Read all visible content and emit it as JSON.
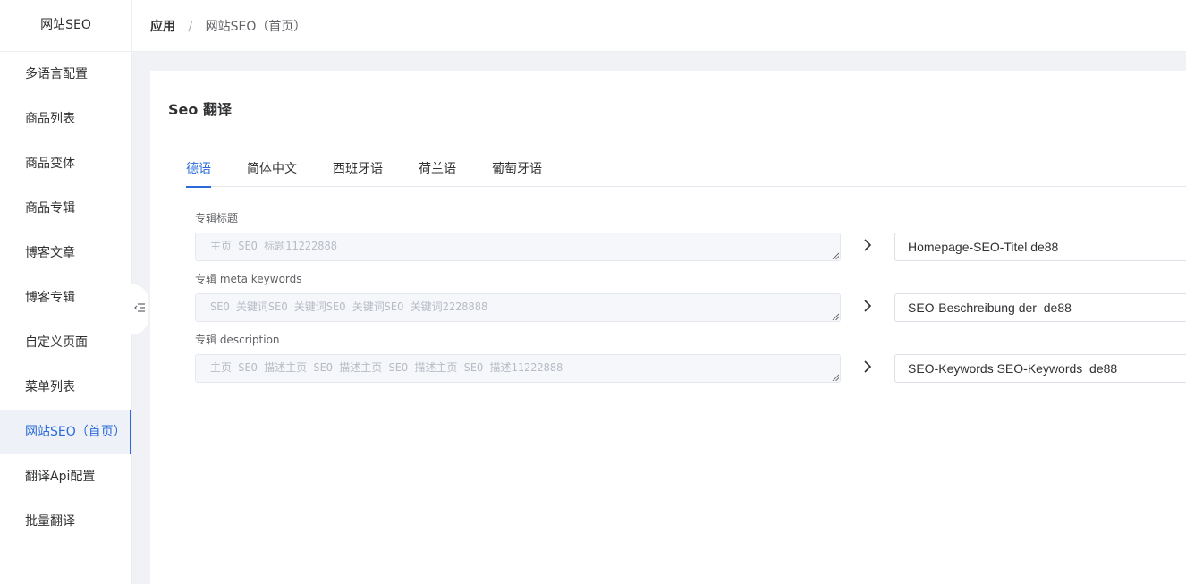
{
  "sidebar": {
    "brand": "网站SEO",
    "items": [
      {
        "label": "多语言配置",
        "active": false
      },
      {
        "label": "商品列表",
        "active": false
      },
      {
        "label": "商品变体",
        "active": false
      },
      {
        "label": "商品专辑",
        "active": false
      },
      {
        "label": "博客文章",
        "active": false
      },
      {
        "label": "博客专辑",
        "active": false
      },
      {
        "label": "自定义页面",
        "active": false
      },
      {
        "label": "菜单列表",
        "active": false
      },
      {
        "label": "网站SEO（首页）",
        "active": true
      },
      {
        "label": "翻译Api配置",
        "active": false
      },
      {
        "label": "批量翻译",
        "active": false
      }
    ]
  },
  "breadcrumb": {
    "root": "应用",
    "separator": "/",
    "current": "网站SEO（首页）"
  },
  "page": {
    "title": "Seo 翻译"
  },
  "tabs": [
    {
      "label": "德语",
      "active": true
    },
    {
      "label": "简体中文",
      "active": false
    },
    {
      "label": "西班牙语",
      "active": false
    },
    {
      "label": "荷兰语",
      "active": false
    },
    {
      "label": "葡萄牙语",
      "active": false
    }
  ],
  "fields": [
    {
      "label": "专辑标题",
      "source": "主页 SEO 标题11222888",
      "target": "Homepage-SEO-Titel de88"
    },
    {
      "label": "专辑 meta keywords",
      "source": "SEO 关键词SEO 关键词SEO 关键词SEO 关键词2228888",
      "target": "SEO-Beschreibung der  de88"
    },
    {
      "label": "专辑 description",
      "source": "主页 SEO 描述主页 SEO 描述主页 SEO 描述主页 SEO 描述11222888",
      "target": "SEO-Keywords SEO-Keywords  de88"
    }
  ],
  "icons": {
    "collapse": "indent-fold-icon",
    "translate_arrow": "chevron-right-icon",
    "resize": "resize-grip-icon"
  },
  "colors": {
    "accent": "#2a6ad8",
    "active_bg": "#eef2f8",
    "page_bg": "#f0f2f5"
  }
}
